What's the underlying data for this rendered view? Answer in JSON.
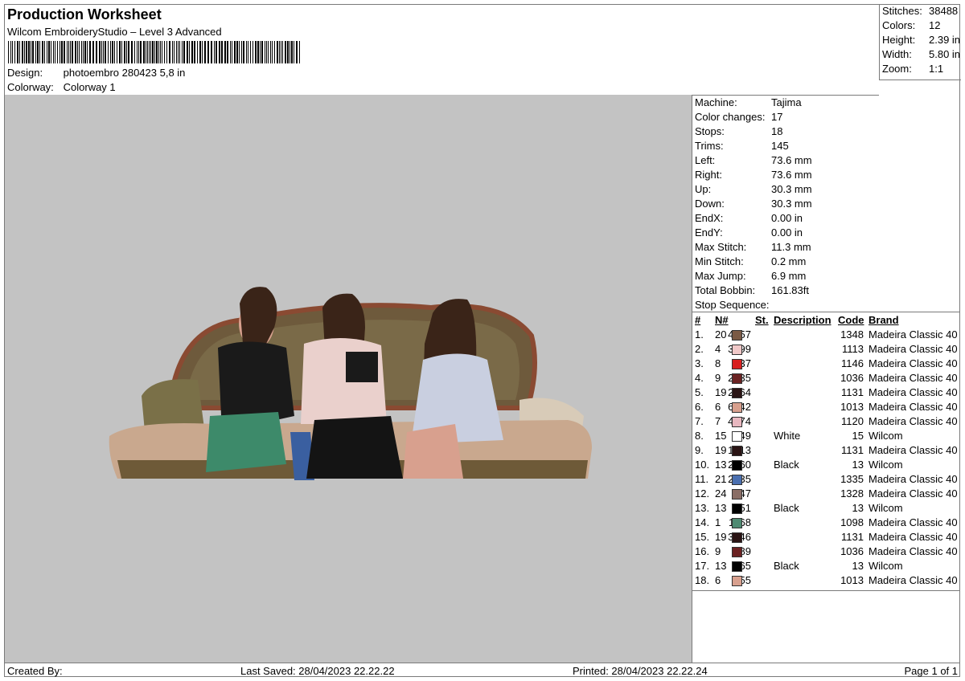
{
  "header": {
    "title": "Production Worksheet",
    "subtitle": "Wilcom EmbroideryStudio – Level 3 Advanced",
    "design_label": "Design:",
    "design_value": "photoembro 280423 5,8 in",
    "colorway_label": "Colorway:",
    "colorway_value": "Colorway 1"
  },
  "stats": [
    {
      "label": "Stitches:",
      "value": "38488"
    },
    {
      "label": "Colors:",
      "value": "12"
    },
    {
      "label": "Height:",
      "value": "2.39 in"
    },
    {
      "label": "Width:",
      "value": "5.80 in"
    },
    {
      "label": "Zoom:",
      "value": "1:1"
    }
  ],
  "machine": [
    {
      "label": "Machine:",
      "value": "Tajima"
    },
    {
      "label": "Color changes:",
      "value": "17"
    },
    {
      "label": "Stops:",
      "value": "18"
    },
    {
      "label": "Trims:",
      "value": "145"
    },
    {
      "label": "Left:",
      "value": "73.6 mm"
    },
    {
      "label": "Right:",
      "value": "73.6 mm"
    },
    {
      "label": "Up:",
      "value": "30.3 mm"
    },
    {
      "label": "Down:",
      "value": "30.3 mm"
    },
    {
      "label": "EndX:",
      "value": "0.00 in"
    },
    {
      "label": "EndY:",
      "value": "0.00 in"
    },
    {
      "label": "Max Stitch:",
      "value": "11.3 mm"
    },
    {
      "label": "Min Stitch:",
      "value": "0.2 mm"
    },
    {
      "label": "Max Jump:",
      "value": "6.9 mm"
    },
    {
      "label": "Total Bobbin:",
      "value": "161.83ft"
    }
  ],
  "sequence": {
    "title": "Stop Sequence:",
    "headers": [
      "#",
      "N#",
      "St.",
      "Description",
      "Code",
      "Brand"
    ],
    "rows": [
      {
        "idx": "1.",
        "n": "20",
        "color": "#7a5a45",
        "st": "4657",
        "desc": "",
        "code": "1348",
        "brand": "Madeira Classic 40"
      },
      {
        "idx": "2.",
        "n": "4",
        "color": "#f0c8c8",
        "st": "3099",
        "desc": "",
        "code": "1113",
        "brand": "Madeira Classic 40"
      },
      {
        "idx": "3.",
        "n": "8",
        "color": "#d82020",
        "st": "237",
        "desc": "",
        "code": "1146",
        "brand": "Madeira Classic 40"
      },
      {
        "idx": "4.",
        "n": "9",
        "color": "#6b2222",
        "st": "2335",
        "desc": "",
        "code": "1036",
        "brand": "Madeira Classic 40"
      },
      {
        "idx": "5.",
        "n": "19",
        "color": "#2a1414",
        "st": "2764",
        "desc": "",
        "code": "1131",
        "brand": "Madeira Classic 40"
      },
      {
        "idx": "6.",
        "n": "6",
        "color": "#d8a08e",
        "st": "6242",
        "desc": "",
        "code": "1013",
        "brand": "Madeira Classic 40"
      },
      {
        "idx": "7.",
        "n": "7",
        "color": "#e8b8c0",
        "st": "4674",
        "desc": "",
        "code": "1120",
        "brand": "Madeira Classic 40"
      },
      {
        "idx": "8.",
        "n": "15",
        "color": "#ffffff",
        "st": "449",
        "desc": "White",
        "code": "15",
        "brand": "Wilcom"
      },
      {
        "idx": "9.",
        "n": "19",
        "color": "#2a1414",
        "st": "1913",
        "desc": "",
        "code": "1131",
        "brand": "Madeira Classic 40"
      },
      {
        "idx": "10.",
        "n": "13",
        "color": "#000000",
        "st": "2160",
        "desc": "Black",
        "code": "13",
        "brand": "Wilcom"
      },
      {
        "idx": "11.",
        "n": "21",
        "color": "#4a6fb0",
        "st": "2335",
        "desc": "",
        "code": "1335",
        "brand": "Madeira Classic 40"
      },
      {
        "idx": "12.",
        "n": "24",
        "color": "#8a6e66",
        "st": "847",
        "desc": "",
        "code": "1328",
        "brand": "Madeira Classic 40"
      },
      {
        "idx": "13.",
        "n": "13",
        "color": "#000000",
        "st": "551",
        "desc": "Black",
        "code": "13",
        "brand": "Wilcom"
      },
      {
        "idx": "14.",
        "n": "1",
        "color": "#4f8a72",
        "st": "1168",
        "desc": "",
        "code": "1098",
        "brand": "Madeira Classic 40"
      },
      {
        "idx": "15.",
        "n": "19",
        "color": "#2a1414",
        "st": "3546",
        "desc": "",
        "code": "1131",
        "brand": "Madeira Classic 40"
      },
      {
        "idx": "16.",
        "n": "9",
        "color": "#6b2222",
        "st": "589",
        "desc": "",
        "code": "1036",
        "brand": "Madeira Classic 40"
      },
      {
        "idx": "17.",
        "n": "13",
        "color": "#000000",
        "st": "765",
        "desc": "Black",
        "code": "13",
        "brand": "Wilcom"
      },
      {
        "idx": "18.",
        "n": "6",
        "color": "#d8a08e",
        "st": "155",
        "desc": "",
        "code": "1013",
        "brand": "Madeira Classic 40"
      }
    ]
  },
  "footer": {
    "created": "Created By:",
    "saved": "Last Saved: 28/04/2023 22.22.22",
    "printed": "Printed: 28/04/2023 22.22.24",
    "page": "Page 1 of 1"
  }
}
